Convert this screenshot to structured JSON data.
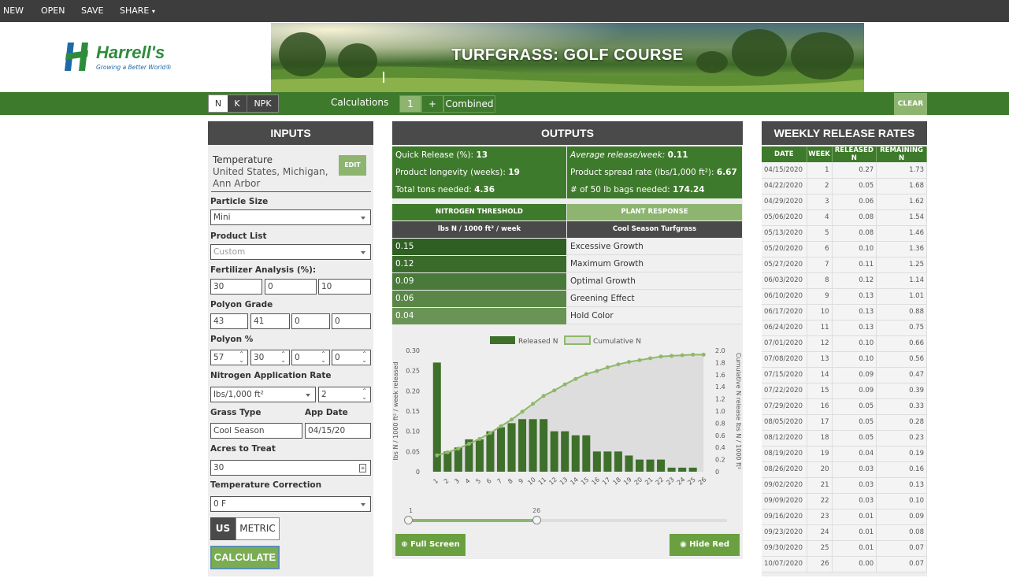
{
  "topnav": {
    "items": [
      "NEW",
      "OPEN",
      "SAVE",
      "SHARE"
    ]
  },
  "logo": {
    "name": "Harrell's",
    "tagline": "Growing a Better World®"
  },
  "banner": {
    "title": "TURFGRASS: GOLF COURSE"
  },
  "toolbar": {
    "nutrient_tabs": [
      "N",
      "K",
      "NPK"
    ],
    "calculations_label": "Calculations",
    "calc_tab": "1",
    "add_label": "+",
    "combined_label": "Combined",
    "clear_label": "CLEAR"
  },
  "inputs": {
    "heading": "INPUTS",
    "temperature_label": "Temperature",
    "location": "United States, Michigan, Ann Arbor",
    "edit_label": "EDIT",
    "particle_size_label": "Particle Size",
    "particle_size_value": "Mini",
    "product_list_label": "Product List",
    "product_list_value": "Custom",
    "fert_label": "Fertilizer Analysis (%):",
    "fert_values": [
      "30",
      "0",
      "10"
    ],
    "polyon_grade_label": "Polyon Grade",
    "polyon_grade_values": [
      "43",
      "41",
      "0",
      "0"
    ],
    "polyon_pct_label": "Polyon %",
    "polyon_pct_values": [
      "57",
      "30",
      "0",
      "0"
    ],
    "n_rate_label": "Nitrogen Application Rate",
    "n_rate_unit": "lbs/1,000 ft²",
    "n_rate_value": "2",
    "grass_type_label": "Grass Type",
    "grass_type_value": "Cool Season",
    "app_date_label": "App Date",
    "app_date_value": "04/15/20",
    "acres_label": "Acres to Treat",
    "acres_value": "30",
    "temp_corr_label": "Temperature Correction",
    "temp_corr_value": "0 F",
    "unit_us": "US",
    "unit_metric": "METRIC",
    "calculate_label": "CALCULATE"
  },
  "outputs": {
    "heading": "OUTPUTS",
    "quick_release_label": "Quick Release (%):",
    "quick_release": "13",
    "avg_release_label": "Average release/week:",
    "avg_release": "0.11",
    "longevity_label": "Product longevity (weeks):",
    "longevity": "19",
    "spread_label": "Product spread rate (lbs/1,000 ft²):",
    "spread": "6.67",
    "tons_label": "Total tons needed:",
    "tons": "4.36",
    "bags_label": "# of 50 lb bags needed:",
    "bags": "174.24",
    "threshold_tab": "NITROGEN THRESHOLD",
    "response_tab": "PLANT RESPONSE",
    "threshold_col": "lbs N / 1000 ft² / week",
    "response_col": "Cool Season Turfgrass",
    "thresholds": [
      {
        "value": "0.15",
        "response": "Excessive Growth",
        "color": "#2f5f22"
      },
      {
        "value": "0.12",
        "response": "Maximum Growth",
        "color": "#3a6b2c"
      },
      {
        "value": "0.09",
        "response": "Optimal Growth",
        "color": "#4a7a3a"
      },
      {
        "value": "0.06",
        "response": "Greening Effect",
        "color": "#5a8748"
      },
      {
        "value": "0.04",
        "response": "Hold Color",
        "color": "#6a9456"
      }
    ],
    "full_screen_label": "Full Screen",
    "hide_red_line_label": "Hide Red Line",
    "slider_min": "1",
    "slider_max": "26"
  },
  "chart_data": {
    "type": "bar",
    "legend": [
      "Released N",
      "Cumulative N"
    ],
    "legend_position": "top-center",
    "xlabel": "weeks",
    "ylabel": "lbs N / 1000 ft² / week released",
    "y2label": "Cumulative N release lbs N / 1000 ft²",
    "categories": [
      "1",
      "2",
      "3",
      "4",
      "5",
      "6",
      "7",
      "8",
      "9",
      "10",
      "11",
      "12",
      "13",
      "14",
      "15",
      "16",
      "17",
      "18",
      "19",
      "20",
      "21",
      "22",
      "23",
      "24",
      "25",
      "26"
    ],
    "series": [
      {
        "name": "Released N",
        "type": "bar",
        "values": [
          0.27,
          0.05,
          0.06,
          0.08,
          0.08,
          0.1,
          0.11,
          0.12,
          0.13,
          0.13,
          0.13,
          0.1,
          0.1,
          0.09,
          0.09,
          0.05,
          0.05,
          0.05,
          0.04,
          0.03,
          0.03,
          0.03,
          0.01,
          0.01,
          0.01,
          0.0
        ]
      },
      {
        "name": "Cumulative N",
        "type": "area",
        "axis": "right",
        "values": [
          0.27,
          0.32,
          0.38,
          0.46,
          0.54,
          0.64,
          0.75,
          0.86,
          0.99,
          1.12,
          1.25,
          1.34,
          1.44,
          1.53,
          1.61,
          1.66,
          1.72,
          1.77,
          1.81,
          1.84,
          1.87,
          1.9,
          1.91,
          1.92,
          1.93,
          1.93
        ]
      }
    ],
    "ylim": [
      0,
      0.3
    ],
    "y2lim": [
      0,
      2.0
    ],
    "yticks": [
      "0.30",
      "0.25",
      "0.20",
      "0.15",
      "0.10",
      "0.05",
      "0"
    ],
    "y2ticks": [
      "2.0",
      "1.8",
      "1.6",
      "1.4",
      "1.2",
      "1.0",
      "0.8",
      "0.6",
      "0.4",
      "0.2",
      "0"
    ],
    "bar_color": "#3e6f2b",
    "line_color": "#8fb86a"
  },
  "weekly": {
    "heading": "WEEKLY RELEASE RATES",
    "columns": [
      "DATE",
      "WEEK",
      "RELEASED N",
      "REMAINING N"
    ],
    "rows": [
      [
        "04/15/2020",
        "1",
        "0.27",
        "1.73"
      ],
      [
        "04/22/2020",
        "2",
        "0.05",
        "1.68"
      ],
      [
        "04/29/2020",
        "3",
        "0.06",
        "1.62"
      ],
      [
        "05/06/2020",
        "4",
        "0.08",
        "1.54"
      ],
      [
        "05/13/2020",
        "5",
        "0.08",
        "1.46"
      ],
      [
        "05/20/2020",
        "6",
        "0.10",
        "1.36"
      ],
      [
        "05/27/2020",
        "7",
        "0.11",
        "1.25"
      ],
      [
        "06/03/2020",
        "8",
        "0.12",
        "1.14"
      ],
      [
        "06/10/2020",
        "9",
        "0.13",
        "1.01"
      ],
      [
        "06/17/2020",
        "10",
        "0.13",
        "0.88"
      ],
      [
        "06/24/2020",
        "11",
        "0.13",
        "0.75"
      ],
      [
        "07/01/2020",
        "12",
        "0.10",
        "0.66"
      ],
      [
        "07/08/2020",
        "13",
        "0.10",
        "0.56"
      ],
      [
        "07/15/2020",
        "14",
        "0.09",
        "0.47"
      ],
      [
        "07/22/2020",
        "15",
        "0.09",
        "0.39"
      ],
      [
        "07/29/2020",
        "16",
        "0.05",
        "0.33"
      ],
      [
        "08/05/2020",
        "17",
        "0.05",
        "0.28"
      ],
      [
        "08/12/2020",
        "18",
        "0.05",
        "0.23"
      ],
      [
        "08/19/2020",
        "19",
        "0.04",
        "0.19"
      ],
      [
        "08/26/2020",
        "20",
        "0.03",
        "0.16"
      ],
      [
        "09/02/2020",
        "21",
        "0.03",
        "0.13"
      ],
      [
        "09/09/2020",
        "22",
        "0.03",
        "0.10"
      ],
      [
        "09/16/2020",
        "23",
        "0.01",
        "0.09"
      ],
      [
        "09/23/2020",
        "24",
        "0.01",
        "0.08"
      ],
      [
        "09/30/2020",
        "25",
        "0.01",
        "0.07"
      ],
      [
        "10/07/2020",
        "26",
        "0.00",
        "0.07"
      ]
    ]
  }
}
